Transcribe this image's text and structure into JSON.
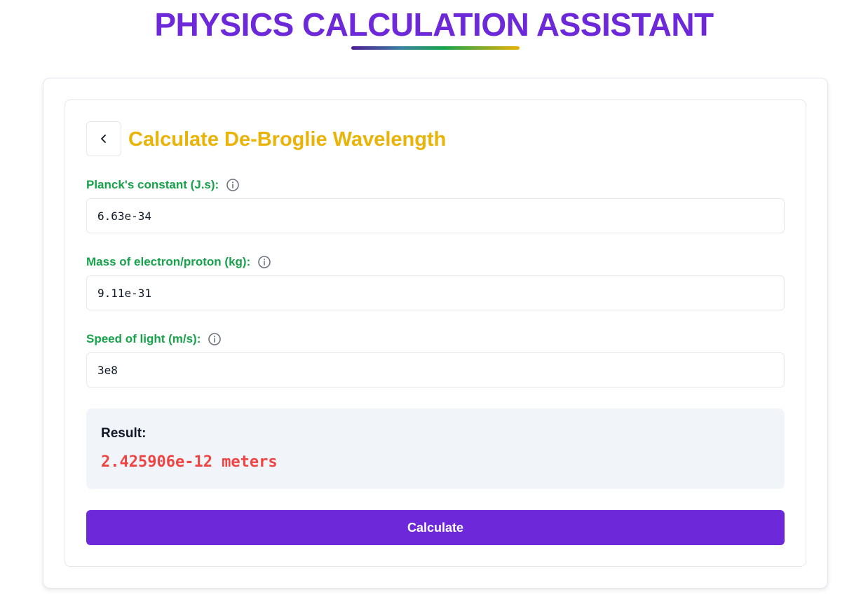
{
  "app": {
    "title": "PHYSICS CALCULATION ASSISTANT"
  },
  "calculator": {
    "title": "Calculate De-Broglie Wavelength",
    "back_icon": "chevron-left-icon",
    "fields": [
      {
        "label": "Planck's constant (J.s):",
        "value": "6.63e-34",
        "icon": "info-icon"
      },
      {
        "label": "Mass of electron/proton (kg):",
        "value": "9.11e-31",
        "icon": "info-icon"
      },
      {
        "label": "Speed of light (m/s):",
        "value": "3e8",
        "icon": "info-icon"
      }
    ],
    "result": {
      "label": "Result:",
      "value": "2.425906e-12 meters"
    },
    "calculate_label": "Calculate"
  },
  "colors": {
    "title": "#6d28d9",
    "subtitle": "#eab308",
    "label": "#16a34a",
    "result_value": "#ef4444",
    "button": "#6d28d9"
  }
}
